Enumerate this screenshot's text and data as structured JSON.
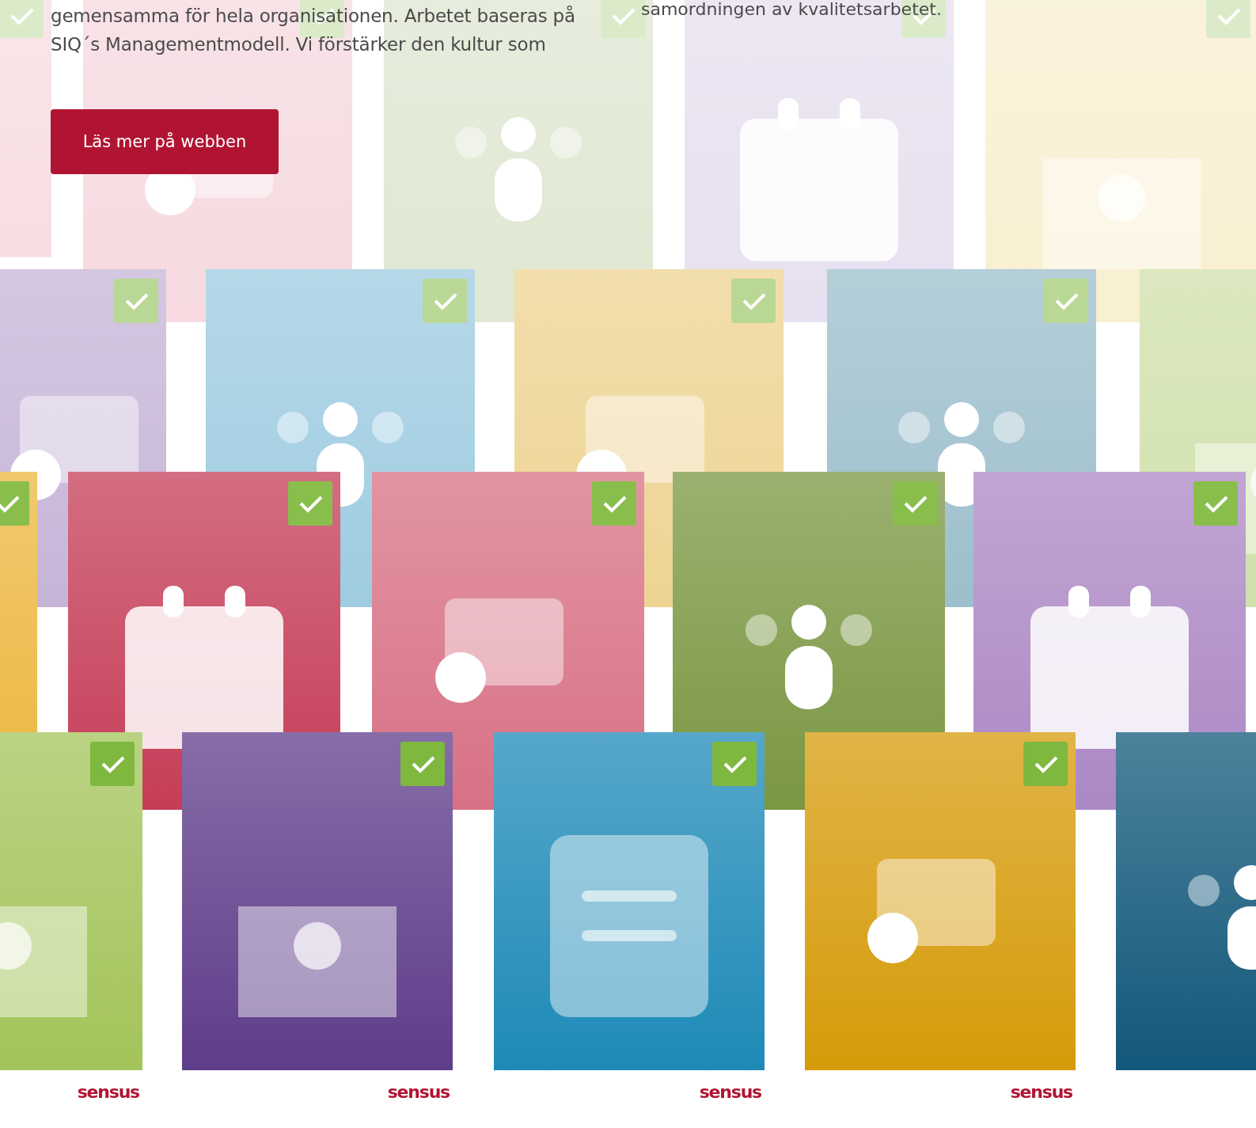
{
  "intro": {
    "lines": [
      "gemensamma för hela organisationen. Arbetet baseras på",
      "SIQ´s Managementmodell. Vi förstärker den kultur som"
    ]
  },
  "side_text": "samordningen av kvalitetsarbetet.",
  "button": {
    "label": "Läs mer på webben"
  },
  "cards": [
    {
      "logo": "sensus"
    },
    {
      "logo": "sensus"
    },
    {
      "logo": "sensus"
    },
    {
      "logo": "sensus"
    }
  ]
}
